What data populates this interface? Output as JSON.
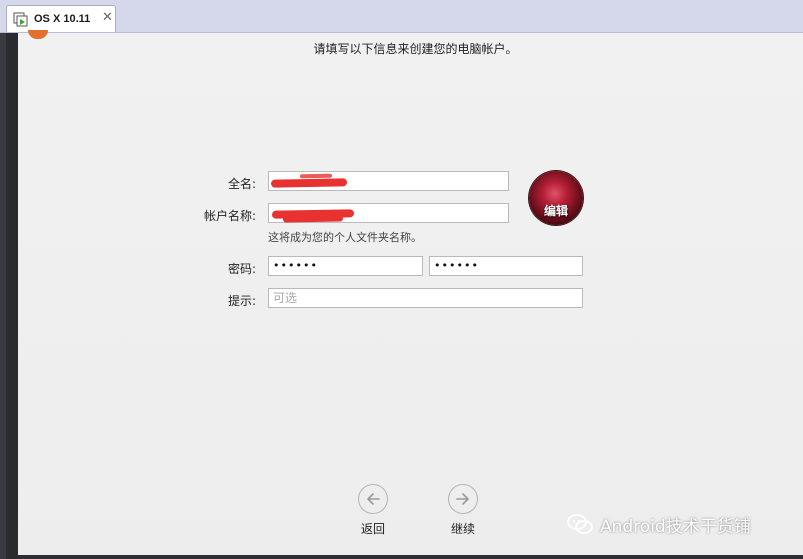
{
  "vm_tab": {
    "title": "OS X 10.11",
    "close_glyph": "✕",
    "icon": "vm-icon"
  },
  "setup": {
    "instruction": "请填写以下信息来创建您的电脑帐户。",
    "full_name": {
      "label": "全名:",
      "value": ""
    },
    "account_name": {
      "label": "帐户名称:",
      "value": "",
      "hint": "这将成为您的个人文件夹名称。"
    },
    "password": {
      "label": "密码:",
      "value": "••••••",
      "verify_value": "••••••"
    },
    "hint": {
      "label": "提示:",
      "placeholder": "可选"
    },
    "avatar": {
      "edit_label": "编辑"
    },
    "nav": {
      "back_label": "返回",
      "continue_label": "继续"
    }
  },
  "watermark": {
    "text": "Android技术干货铺",
    "icon": "wechat-icon"
  },
  "colors": {
    "redaction": "#e8322f",
    "tabbar": "#d4d8ea",
    "pane": "#f0f0f0"
  }
}
